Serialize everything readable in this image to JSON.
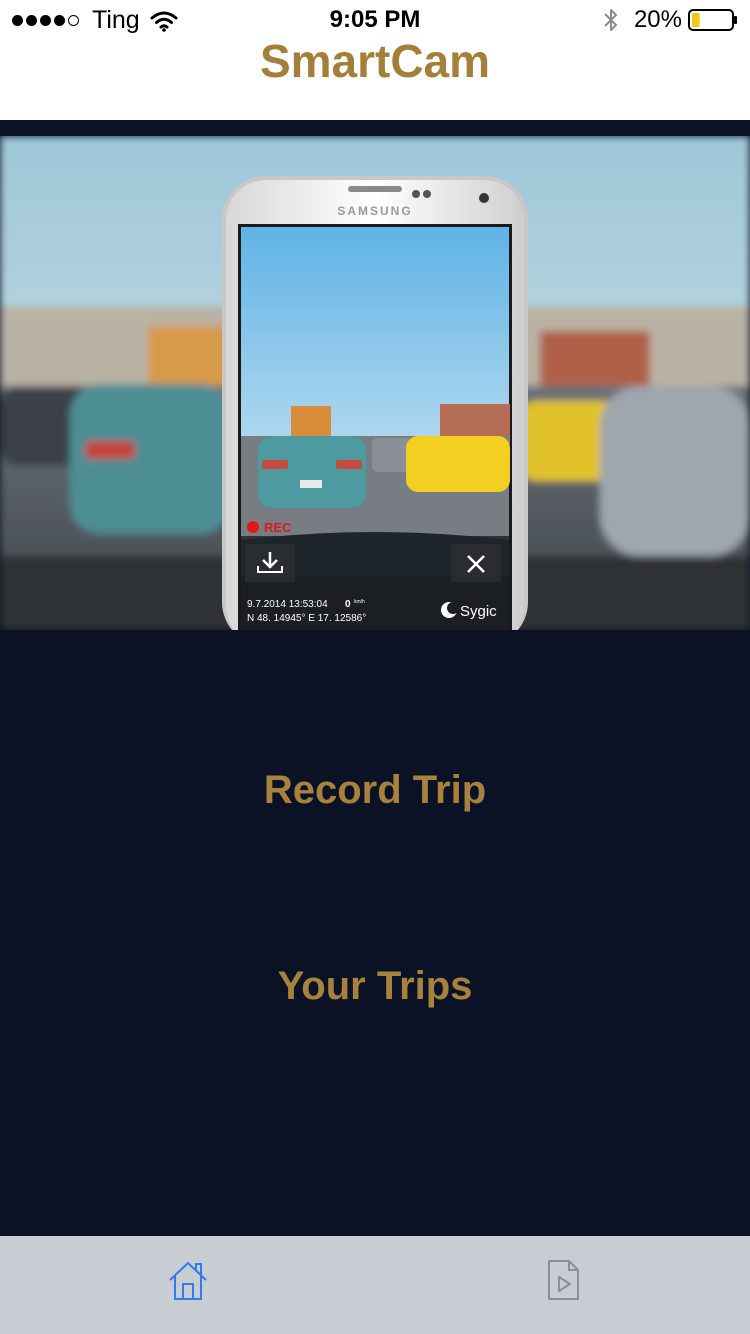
{
  "status_bar": {
    "carrier": "Ting",
    "time": "9:05 PM",
    "battery": "20%",
    "signal_bars_filled": 4,
    "signal_bars_total": 5,
    "battery_level": 0.2
  },
  "header": {
    "title": "SmartCam"
  },
  "hero": {
    "phone_brand": "SAMSUNG",
    "rec_label": "REC",
    "overlay_datetime": "9.7.2014 13:53:04",
    "overlay_speed": "0",
    "overlay_speed_unit": "km/h",
    "overlay_coords": "N 48. 14945°  E 17. 12586°",
    "overlay_brand": "Sygic"
  },
  "main": {
    "record_trip": "Record Trip",
    "your_trips": "Your Trips"
  },
  "tabbar": {
    "tabs": [
      {
        "icon": "home-icon",
        "active": true
      },
      {
        "icon": "video-file-icon",
        "active": false
      }
    ]
  },
  "colors": {
    "accent_gold": "#a6823c",
    "background_navy": "#0c1226",
    "tabbar_bg": "#c8ccd3",
    "tab_active": "#2f7bf0",
    "tab_inactive": "#8a8e96"
  }
}
